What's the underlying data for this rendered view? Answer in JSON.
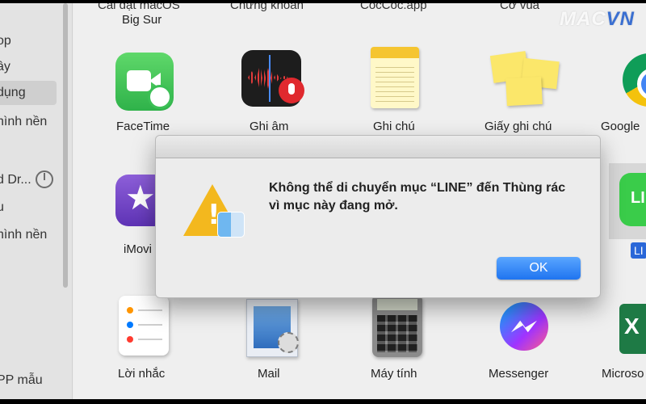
{
  "sidebar": {
    "items": [
      {
        "label": "op"
      },
      {
        "label": "ây"
      },
      {
        "label": "dụng"
      },
      {
        "label": "hình nền"
      },
      {
        "label": "d Dr..."
      },
      {
        "label": "u"
      },
      {
        "label": "hình nền"
      },
      {
        "label": "PP mẫu"
      }
    ]
  },
  "top_row": {
    "labels": [
      "Cài đặt macOS",
      "Chứng khoán",
      "CocCoc.app",
      "Cờ vua"
    ],
    "big_sur": "Big Sur"
  },
  "apps": [
    {
      "label": "FaceTime",
      "icon": "facetime-icon"
    },
    {
      "label": "Ghi âm",
      "icon": "voice-memos-icon"
    },
    {
      "label": "Ghi chú",
      "icon": "notes-icon"
    },
    {
      "label": "Giấy ghi chú",
      "icon": "stickies-icon"
    },
    {
      "label": "Google",
      "icon": "chrome-icon"
    },
    {
      "label": "iMovi",
      "icon": "imovie-icon"
    },
    {
      "label": "LI",
      "icon": "line-icon"
    },
    {
      "label": "Lời nhắc",
      "icon": "reminders-icon"
    },
    {
      "label": "Mail",
      "icon": "mail-icon"
    },
    {
      "label": "Máy tính",
      "icon": "calculator-icon"
    },
    {
      "label": "Messenger",
      "icon": "messenger-icon"
    },
    {
      "label": "Microso",
      "icon": "excel-icon"
    }
  ],
  "icon_text": {
    "line": "LI",
    "excel": "X"
  },
  "dialog": {
    "message": "Không thể di chuyển mục “LINE” đến Thùng rác vì mục này đang mở.",
    "ok_label": "OK",
    "icon": "warning-icon"
  },
  "watermark": {
    "text": "MAC",
    "suffix": "VN"
  },
  "colors": {
    "accent": "#1f74f0",
    "warning": "#f3b81e"
  }
}
